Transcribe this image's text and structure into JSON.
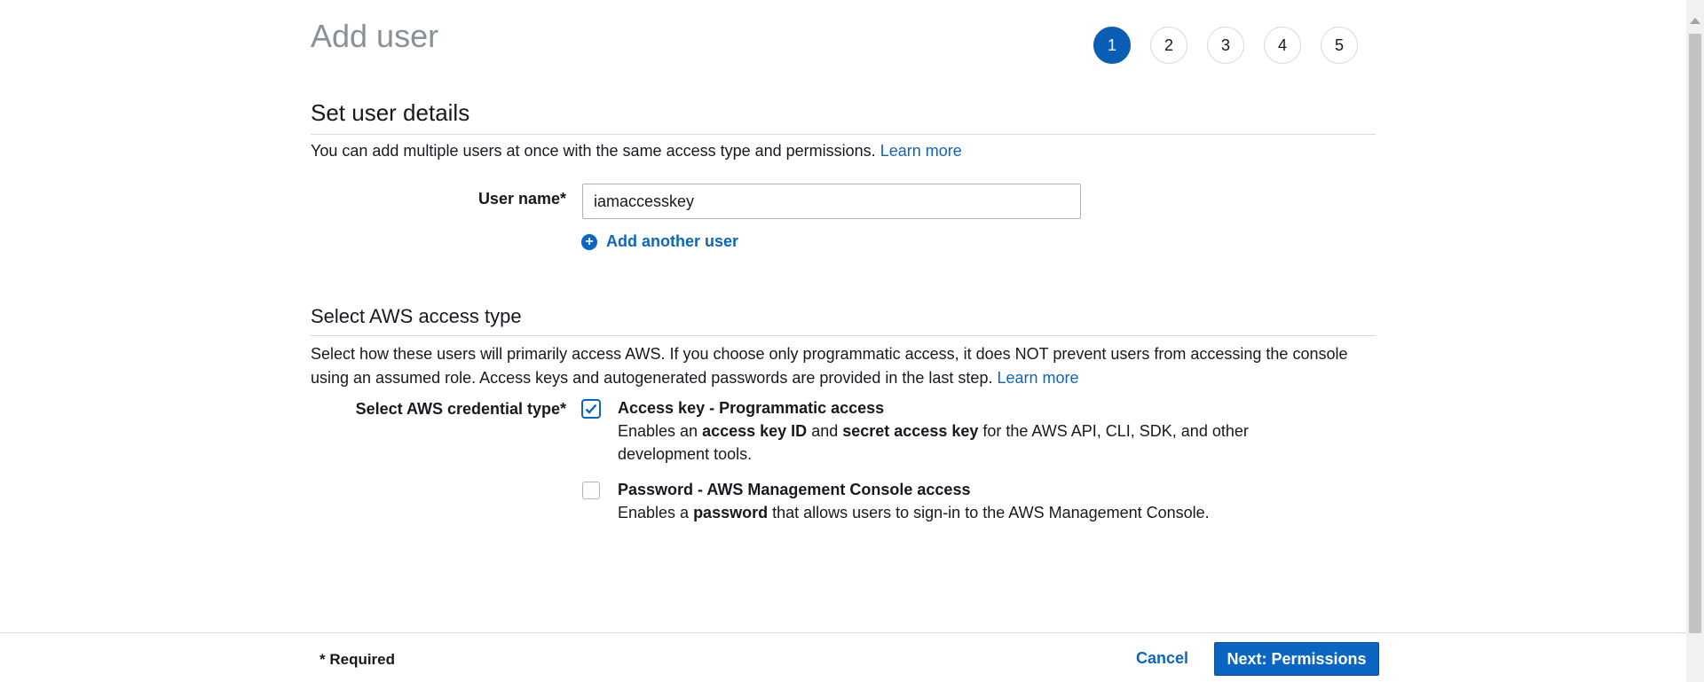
{
  "page": {
    "title": "Add user"
  },
  "steps": [
    "1",
    "2",
    "3",
    "4",
    "5"
  ],
  "user_details": {
    "heading": "Set user details",
    "description": "You can add multiple users at once with the same access type and permissions.",
    "learn_more": "Learn more",
    "username_label": "User name*",
    "username_value": "iamaccesskey",
    "add_another_user": "Add another user"
  },
  "access_type": {
    "heading": "Select AWS access type",
    "description": "Select how these users will primarily access AWS. If you choose only programmatic access, it does NOT prevent users from accessing the console using an assumed role. Access keys and autogenerated passwords are provided in the last step.",
    "learn_more": "Learn more",
    "credential_label": "Select AWS credential type*",
    "options": [
      {
        "title": "Access key - Programmatic access",
        "desc_before": "Enables an ",
        "bold1": "access key ID",
        "desc_mid": " and ",
        "bold2": "secret access key",
        "desc_after": " for the AWS API, CLI, SDK, and other development tools.",
        "checked": true
      },
      {
        "title": "Password - AWS Management Console access",
        "desc_before": "Enables a ",
        "bold1": "password",
        "desc_after": " that allows users to sign-in to the AWS Management Console.",
        "checked": false
      }
    ]
  },
  "footer": {
    "required_note": "* Required",
    "cancel_label": "Cancel",
    "next_label": "Next: Permissions"
  },
  "colors": {
    "accent": "#0a66c2",
    "active_step": "#0a5eb5",
    "title_gray": "#879196"
  }
}
